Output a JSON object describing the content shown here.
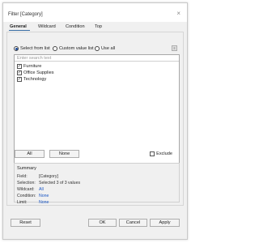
{
  "dialog": {
    "title": "Filter [Category]",
    "close_glyph": "×"
  },
  "tabs": [
    {
      "label": "General",
      "active": true
    },
    {
      "label": "Wildcard",
      "active": false
    },
    {
      "label": "Condition",
      "active": false
    },
    {
      "label": "Top",
      "active": false
    }
  ],
  "mode": {
    "options": [
      {
        "label": "Select from list",
        "selected": true
      },
      {
        "label": "Custom value list",
        "selected": false
      },
      {
        "label": "Use all",
        "selected": false
      }
    ]
  },
  "list": {
    "search_placeholder": "Enter search text",
    "items": [
      {
        "label": "Furniture",
        "checked": true
      },
      {
        "label": "Office Supplies",
        "checked": true
      },
      {
        "label": "Technology",
        "checked": true
      }
    ]
  },
  "buttons": {
    "all": "All",
    "none": "None",
    "exclude": "Exclude",
    "reset": "Reset",
    "ok": "OK",
    "cancel": "Cancel",
    "apply": "Apply"
  },
  "summary": {
    "title": "Summary",
    "rows": [
      {
        "label": "Field:",
        "value": "[Category]",
        "link": false
      },
      {
        "label": "Selection:",
        "value": "Selected 3 of 3 values",
        "link": false
      },
      {
        "label": "Wildcard:",
        "value": "All",
        "link": true
      },
      {
        "label": "Condition:",
        "value": "None",
        "link": true
      },
      {
        "label": "Limit:",
        "value": "None",
        "link": true
      }
    ]
  },
  "colors": {
    "accent": "#3a6ea5",
    "link": "#1a56c4"
  }
}
